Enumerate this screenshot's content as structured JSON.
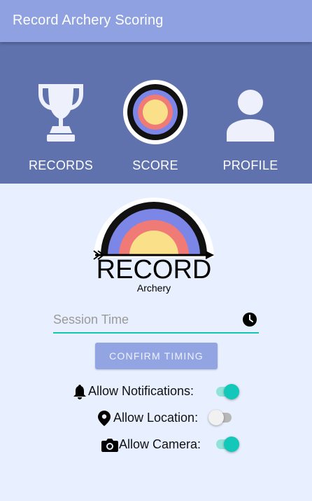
{
  "app": {
    "title": "Record Archery Scoring"
  },
  "nav": {
    "items": [
      {
        "label": "RECORDS",
        "icon": "trophy-icon"
      },
      {
        "label": "SCORE",
        "icon": "target-icon"
      },
      {
        "label": "PROFILE",
        "icon": "person-icon"
      }
    ]
  },
  "logo": {
    "word": "RECORD",
    "sub": "Archery"
  },
  "session": {
    "placeholder": "Session Time",
    "value": "",
    "icon": "clock-icon"
  },
  "confirm": {
    "label": "CONFIRM TIMING"
  },
  "settings": [
    {
      "label": "Allow Notifications:",
      "icon": "bell-icon",
      "on": true
    },
    {
      "label": "Allow Location:",
      "icon": "location-pin-icon",
      "on": false
    },
    {
      "label": "Allow Camera:",
      "icon": "camera-icon",
      "on": true
    }
  ],
  "colors": {
    "appbar": "#8fa1e0",
    "nav": "#5f72ad",
    "accent": "#12c8b8",
    "background": "#e8effe"
  }
}
